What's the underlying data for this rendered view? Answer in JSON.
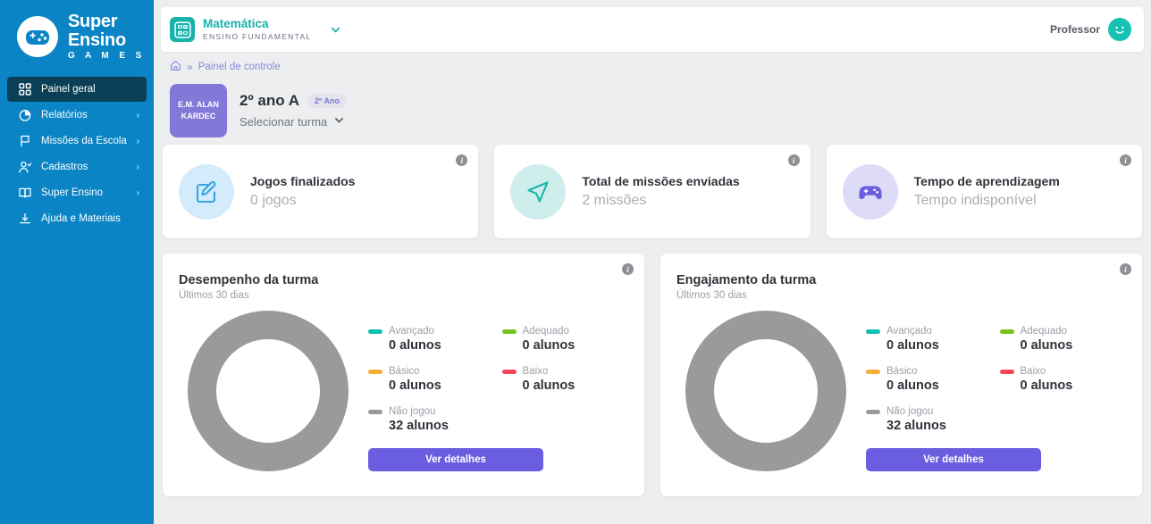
{
  "sidebar": {
    "logo": {
      "line1": "Super",
      "line2": "Ensino",
      "line3": "G A M E S",
      "icon": "gamepad-logo-icon"
    },
    "items": [
      {
        "label": "Painel geral",
        "icon": "grid-icon",
        "chevron": "",
        "active": true
      },
      {
        "label": "Relatórios",
        "icon": "pie-chart-icon",
        "chevron": "›",
        "active": false
      },
      {
        "label": "Missões da Escola",
        "icon": "flag-icon",
        "chevron": "›",
        "active": false
      },
      {
        "label": "Cadastros",
        "icon": "user-check-icon",
        "chevron": "›",
        "active": false
      },
      {
        "label": "Super Ensino",
        "icon": "book-icon",
        "chevron": "›",
        "active": false
      },
      {
        "label": "Ajuda e Materiais",
        "icon": "download-icon",
        "chevron": "",
        "active": false
      }
    ]
  },
  "topbar": {
    "subject": {
      "name": "Matemática",
      "level": "ENSINO FUNDAMENTAL",
      "icon": "calculator-icon",
      "chevron_icon": "chevron-down-icon"
    },
    "user": {
      "name": "Professor",
      "avatar_icon": "smiley-avatar"
    }
  },
  "breadcrumb": {
    "home_icon": "home-icon",
    "separator": "»",
    "current": "Painel de controle"
  },
  "class": {
    "school_line1": "E.M. ALAN",
    "school_line2": "KARDEC",
    "title": "2º ano A",
    "pill": "2º Ano",
    "select_label": "Selecionar turma",
    "select_icon": "chevron-down-icon"
  },
  "stats": [
    {
      "label": "Jogos finalizados",
      "value": "0 jogos",
      "icon": "edit-square-icon",
      "icon_color": "#3aa3e3",
      "icon_bg": "#d3ebfa",
      "info_icon": "info-icon",
      "info_char": "i"
    },
    {
      "label": "Total de missões enviadas",
      "value": "2 missões",
      "icon": "send-icon",
      "icon_color": "#17b3ab",
      "icon_bg": "#cdeeea",
      "info_icon": "info-icon",
      "info_char": "i"
    },
    {
      "label": "Tempo de aprendizagem",
      "value": "Tempo indisponível",
      "icon": "gamepad-icon",
      "icon_color": "#6a5de0",
      "icon_bg": "#dedbf8",
      "info_icon": "info-icon",
      "info_char": "i"
    }
  ],
  "panels": [
    {
      "title": "Desempenho da turma",
      "subtitle": "Últimos 30 dias",
      "button": "Ver detalhes",
      "info_char": "i"
    },
    {
      "title": "Engajamento da turma",
      "subtitle": "Últimos 30 dias",
      "button": "Ver detalhes",
      "info_char": "i"
    }
  ],
  "chart_data": [
    {
      "type": "pie",
      "title": "Desempenho da turma",
      "subtitle": "Últimos 30 dias",
      "labels": [
        "Avançado",
        "Adequado",
        "Básico",
        "Baixo",
        "Não jogou"
      ],
      "values": [
        0,
        0,
        0,
        0,
        32
      ],
      "value_labels": [
        "0 alunos",
        "0 alunos",
        "0 alunos",
        "0 alunos",
        "32 alunos"
      ],
      "colors": [
        "#0dbfb4",
        "#76c322",
        "#f5ad35",
        "#f6465a",
        "#9a9a9a"
      ],
      "legend_position": "right",
      "donut": true,
      "total": 32
    },
    {
      "type": "pie",
      "title": "Engajamento da turma",
      "subtitle": "Últimos 30 dias",
      "labels": [
        "Avançado",
        "Adequado",
        "Básico",
        "Baixo",
        "Não jogou"
      ],
      "values": [
        0,
        0,
        0,
        0,
        32
      ],
      "value_labels": [
        "0 alunos",
        "0 alunos",
        "0 alunos",
        "0 alunos",
        "32 alunos"
      ],
      "colors": [
        "#0dbfb4",
        "#76c322",
        "#f5ad35",
        "#f6465a",
        "#9a9a9a"
      ],
      "legend_position": "right",
      "donut": true,
      "total": 32
    }
  ],
  "colors": {
    "sidebar_bg": "#0a84c4",
    "sidebar_active": "#0b3f57",
    "page_bg": "#eceef0",
    "accent_purple": "#6a5de0",
    "accent_teal": "#17b3ab",
    "donut_gray": "#9a9a9a"
  }
}
